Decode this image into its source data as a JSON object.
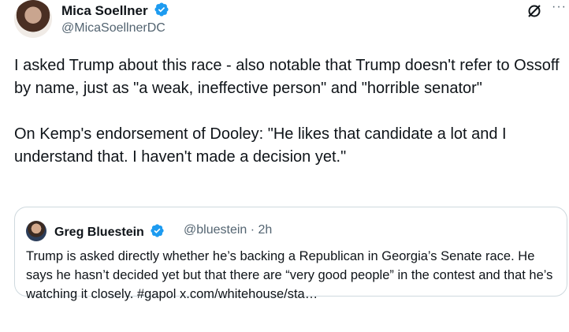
{
  "tweet": {
    "author_name": "Mica Soellner",
    "author_handle": "@MicaSoellnerDC",
    "text": "I asked Trump about this race - also notable that Trump doesn't refer to Ossoff by name, just as \"a weak, ineffective person\" and \"horrible senator\"\n\nOn Kemp's endorsement of Dooley: \"He likes that candidate a lot and I understand that. I haven't made a decision yet.\"",
    "more_label": "···"
  },
  "quote": {
    "author_name": "Greg Bluestein",
    "meta": "@bluestein · 2h",
    "text": "Trump is asked directly whether he’s backing a Republican in Georgia’s Senate race. He says he hasn’t decided yet but that there are “very good people” in the contest and that he’s watching it closely. #gapol x.com/whitehouse/sta…"
  },
  "colors": {
    "verified_blue": "#1d9bf0",
    "secondary_text": "#536471",
    "border": "#cfd9de"
  },
  "icons": [
    "verified-badge-icon",
    "grok-icon",
    "more-icon"
  ]
}
